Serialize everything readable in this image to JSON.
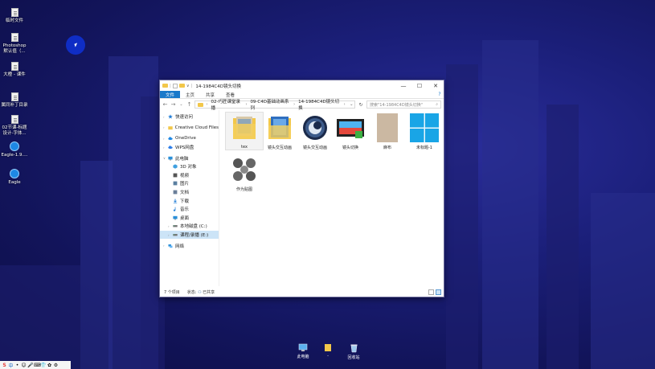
{
  "desktop": {
    "icons": [
      {
        "label": "临时文件",
        "type": "doc"
      },
      {
        "label": "Photoshop 默认值（...",
        "type": "doc"
      },
      {
        "label": "大橙 - 课件",
        "type": "doc"
      },
      {
        "label": "属同补丁目录",
        "type": "doc"
      },
      {
        "label": "02节课-标题设计-字体...",
        "type": "doc"
      },
      {
        "label": "Eagle-1.9....",
        "type": "eagle"
      },
      {
        "label": "Eagle",
        "type": "eagle"
      }
    ],
    "taskbar_icons": [
      {
        "label": "此电脑",
        "icon": "computer-icon"
      },
      {
        "label": "-",
        "icon": "folder-icon"
      },
      {
        "label": "回收站",
        "icon": "recycle-bin-icon"
      }
    ],
    "tray": [
      "S",
      "中",
      "•",
      "☺",
      "🎤",
      "⌨",
      "👕",
      "✿",
      "⚙"
    ]
  },
  "window": {
    "title": "14-1984C4D镜头切换",
    "controls": {
      "minimize": "—",
      "maximize": "☐",
      "close": "✕"
    },
    "ribbon_tabs": [
      "文件",
      "主页",
      "共享",
      "查看"
    ],
    "help": "?",
    "nav_back": "←",
    "nav_forward": "→",
    "nav_recent": "⌄",
    "nav_up": "↑",
    "breadcrumb": [
      "02-巧匠课堂录播",
      "09-C4D基础动画系列",
      "14-1984C4D镜头切换"
    ],
    "address_dropdown": "⌄",
    "refresh": "↻",
    "search_placeholder": "搜索\"14-1984C4D镜头切换\"",
    "search_icon": "⌕"
  },
  "navpane": [
    {
      "label": "快速访问",
      "level": 1,
      "icon": "star-icon",
      "color": "#1e7bd6"
    },
    {
      "label": "Creative Cloud Files",
      "level": 1,
      "icon": "folder-icon",
      "color": "#f2c74a"
    },
    {
      "label": "OneDrive",
      "level": 1,
      "icon": "cloud-icon",
      "color": "#1e88e5"
    },
    {
      "label": "WPS网盘",
      "level": 1,
      "icon": "wps-cloud-icon",
      "color": "#2b7de9"
    },
    {
      "label": "此电脑",
      "level": 1,
      "icon": "computer-icon",
      "color": "#2a8fd8"
    },
    {
      "label": "3D 对象",
      "level": 2,
      "icon": "cube-icon",
      "color": "#3fa0e0"
    },
    {
      "label": "视频",
      "level": 2,
      "icon": "video-icon",
      "color": "#555555"
    },
    {
      "label": "图片",
      "level": 2,
      "icon": "picture-icon",
      "color": "#5a7fa0"
    },
    {
      "label": "文档",
      "level": 2,
      "icon": "document-icon",
      "color": "#6a7f9a"
    },
    {
      "label": "下载",
      "level": 2,
      "icon": "download-icon",
      "color": "#1e7bd6"
    },
    {
      "label": "音乐",
      "level": 2,
      "icon": "music-icon",
      "color": "#1e7bd6"
    },
    {
      "label": "桌面",
      "level": 2,
      "icon": "desktop-icon",
      "color": "#2a8fd8"
    },
    {
      "label": "本地磁盘 (C:)",
      "level": 2,
      "icon": "drive-icon",
      "color": "#777777"
    },
    {
      "label": "课程/录播 (E:)",
      "level": 2,
      "icon": "drive-icon",
      "color": "#777777",
      "selected": true
    },
    {
      "label": "网络",
      "level": 1,
      "icon": "network-icon",
      "color": "#2a8fd8"
    }
  ],
  "files": [
    {
      "name": "tex",
      "kind": "folder-photo"
    },
    {
      "name": "镜头交互动画",
      "kind": "folder-blue"
    },
    {
      "name": "镜头交互动画",
      "kind": "c4d"
    },
    {
      "name": "镜头切换",
      "kind": "video"
    },
    {
      "name": "麻布",
      "kind": "fabric"
    },
    {
      "name": "未标题-1",
      "kind": "windows"
    },
    {
      "name": "作为贴图",
      "kind": "blur"
    }
  ],
  "status": {
    "count": "7 个项目",
    "state_label": "状态:",
    "shared": "已共享"
  }
}
